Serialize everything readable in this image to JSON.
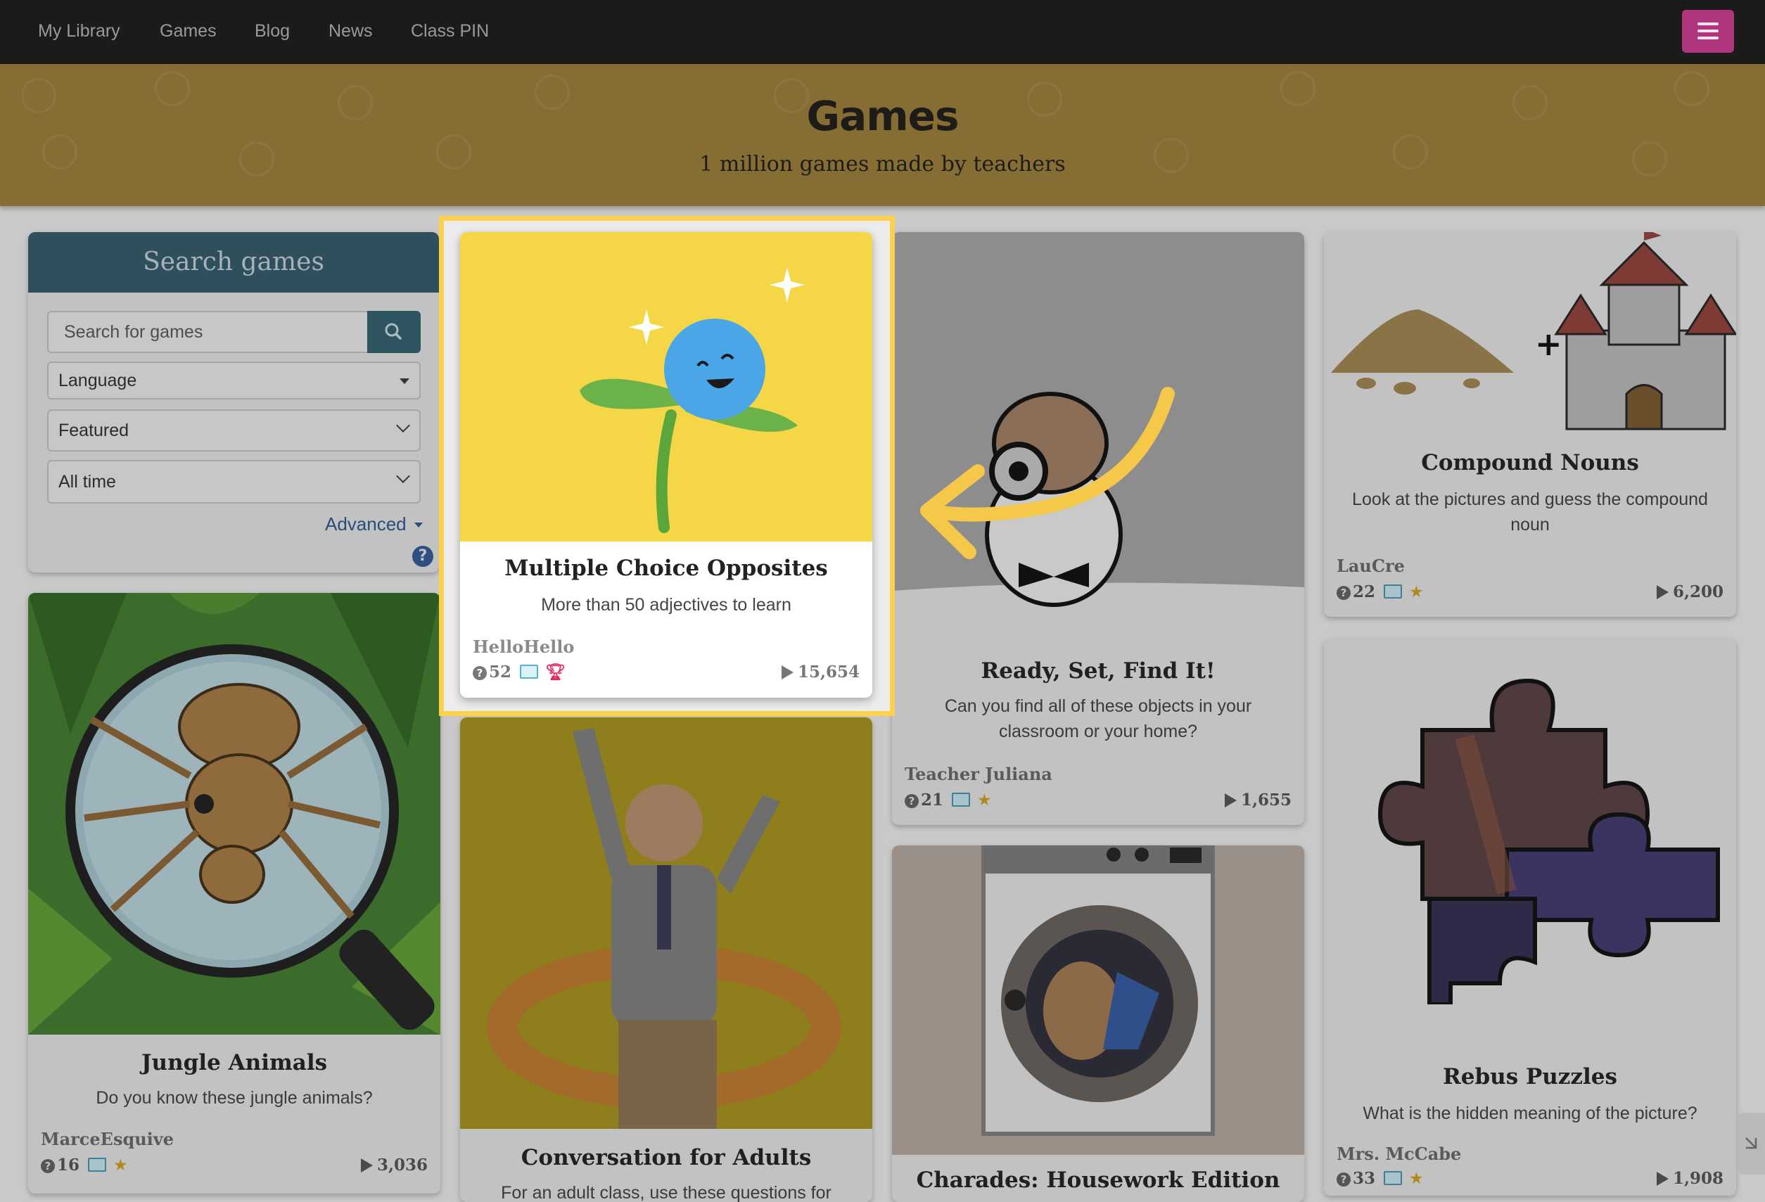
{
  "nav": {
    "links": [
      "My Library",
      "Games",
      "Blog",
      "News",
      "Class PIN"
    ]
  },
  "banner": {
    "title": "Games",
    "subtitle": "1 million games made by teachers"
  },
  "search": {
    "heading": "Search games",
    "placeholder": "Search for games",
    "language": "Language",
    "sort": "Featured",
    "period": "All time",
    "advanced": "Advanced",
    "help": "?"
  },
  "highlight": {
    "title": "Multiple Choice Opposites",
    "desc": "More than 50 adjectives to learn",
    "author": "HelloHello",
    "questions": "52",
    "plays": "15,654"
  },
  "cards": {
    "jungle": {
      "title": "Jungle Animals",
      "desc": "Do you know these jungle animals?",
      "author": "MarceEsquive",
      "questions": "16",
      "plays": "3,036"
    },
    "conversation": {
      "title": "Conversation for Adults",
      "desc": "For an adult class, use these questions for"
    },
    "ready": {
      "title": "Ready, Set, Find It!",
      "desc": "Can you find all of these objects in your classroom or your home?",
      "author": "Teacher Juliana",
      "questions": "21",
      "plays": "1,655"
    },
    "charades": {
      "title": "Charades: Housework Edition"
    },
    "compound": {
      "title": "Compound Nouns",
      "desc": "Look at the pictures and guess the compound noun",
      "author": "LauCre",
      "questions": "22",
      "plays": "6,200"
    },
    "rebus": {
      "title": "Rebus Puzzles",
      "desc": "What is the hidden meaning of the picture?",
      "author": "Mrs. McCabe",
      "questions": "33",
      "plays": "1,908"
    }
  },
  "colors": {
    "navbar": "#1b1b1b",
    "banner": "#866d33",
    "menu_button": "#b0357c",
    "highlight_border": "#fcd24a",
    "arrow": "#f5c84a"
  }
}
